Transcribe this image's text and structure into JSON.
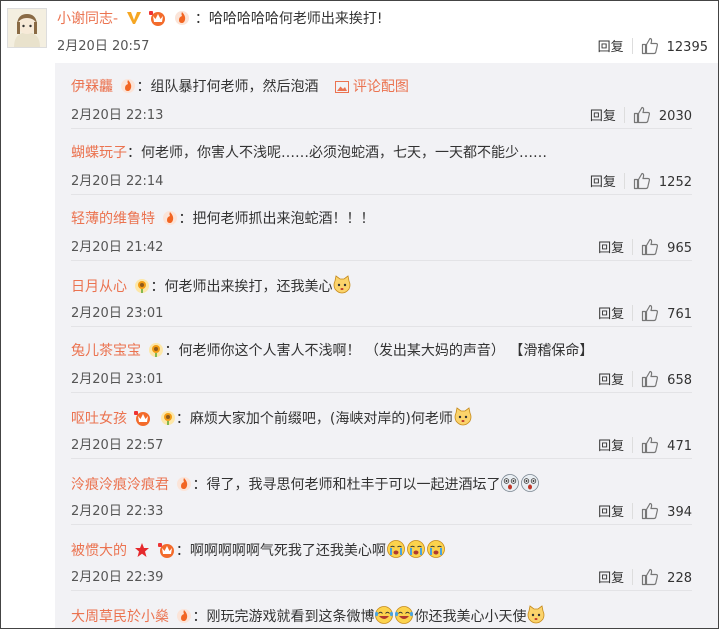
{
  "main_comment": {
    "username": "小谢同志-",
    "text": "哈哈哈哈哈何老师出来挨打!",
    "time": "2月20日 20:57",
    "reply_label": "回复",
    "likes": "12395"
  },
  "replies": [
    {
      "username": "伊槑龘",
      "text": "组队暴打何老师，然后泡酒",
      "extra": "评论配图",
      "time": "2月20日 22:13",
      "reply_label": "回复",
      "likes": "2030"
    },
    {
      "username": "蝴蝶玩子",
      "text": "何老师，你害人不浅呢……必须泡蛇酒，七天，一天都不能少……",
      "time": "2月20日 22:14",
      "reply_label": "回复",
      "likes": "1252"
    },
    {
      "username": "轻薄的维鲁特",
      "text": "把何老师抓出来泡蛇酒！！！",
      "time": "2月20日 21:42",
      "reply_label": "回复",
      "likes": "965"
    },
    {
      "username": "日月从心",
      "text": "何老师出来挨打，还我美心",
      "time": "2月20日 23:01",
      "reply_label": "回复",
      "likes": "761"
    },
    {
      "username": "兔儿茶宝宝",
      "text": "何老师你这个人害人不浅啊！ （发出某大妈的声音） 【滑稽保命】",
      "time": "2月20日 23:01",
      "reply_label": "回复",
      "likes": "658"
    },
    {
      "username": "呕吐女孩",
      "text": "麻烦大家加个前缀吧，(海峡对岸的)何老师",
      "time": "2月20日 22:57",
      "reply_label": "回复",
      "likes": "471"
    },
    {
      "username": "泠痕泠痕泠痕君",
      "text": "得了，我寻思何老师和杜丰于可以一起进酒坛了",
      "time": "2月20日 22:33",
      "reply_label": "回复",
      "likes": "394"
    },
    {
      "username": "被惯大的",
      "text": "啊啊啊啊啊气死我了还我美心啊",
      "time": "2月20日 22:39",
      "reply_label": "回复",
      "likes": "228"
    },
    {
      "username": "大周草民於小燊",
      "text": "刚玩完游戏就看到这条微博",
      "text2": "你还我美心小天使"
    }
  ]
}
